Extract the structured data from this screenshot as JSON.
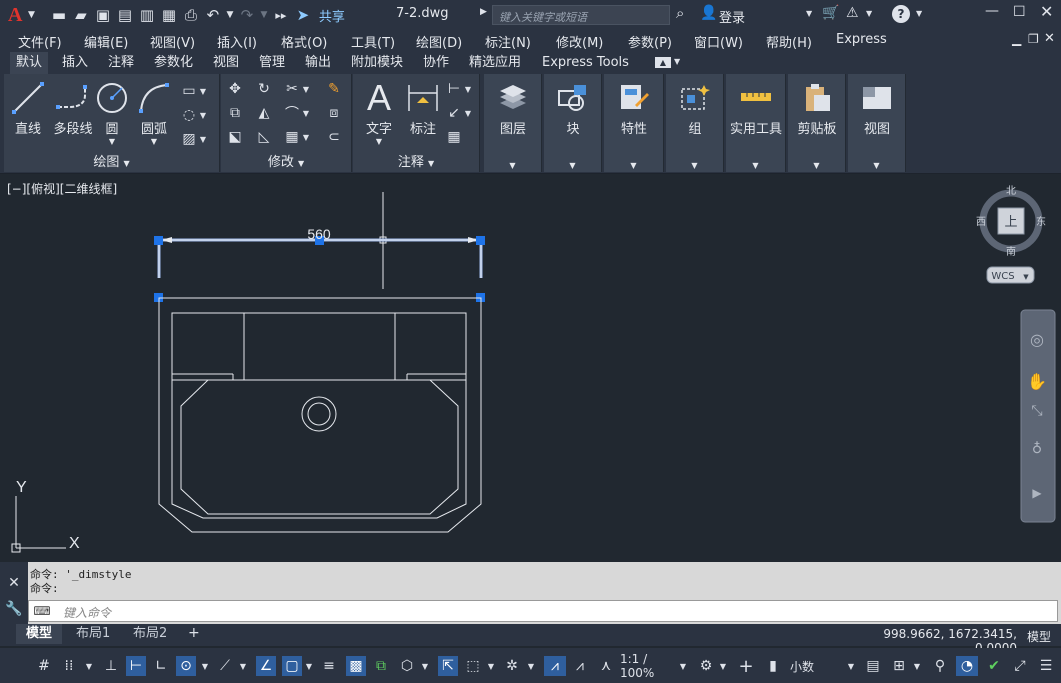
{
  "titlebar": {
    "app_logo": "A",
    "share_label": "共享",
    "filename": "7-2.dwg",
    "search_placeholder": "键入关键字或短语",
    "login_label": "登录"
  },
  "menu": [
    "文件(F)",
    "编辑(E)",
    "视图(V)",
    "插入(I)",
    "格式(O)",
    "工具(T)",
    "绘图(D)",
    "标注(N)",
    "修改(M)",
    "参数(P)",
    "窗口(W)",
    "帮助(H)",
    "Express"
  ],
  "ribbon_tabs": [
    "默认",
    "插入",
    "注释",
    "参数化",
    "视图",
    "管理",
    "输出",
    "附加模块",
    "协作",
    "精选应用",
    "Express Tools"
  ],
  "ribbon": {
    "draw_buttons": [
      "直线",
      "多段线",
      "圆",
      "圆弧"
    ],
    "draw_panel": "绘图",
    "modify_panel": "修改",
    "annot_buttons": [
      "文字",
      "标注"
    ],
    "annot_panel": "注释",
    "big_panels": [
      "图层",
      "块",
      "特性",
      "组",
      "实用工具",
      "剪贴板",
      "视图"
    ]
  },
  "viewport": {
    "label": "[−][俯视][二维线框]",
    "dimension_text": "560",
    "ucs_y": "Y",
    "ucs_x": "X",
    "compass": {
      "north": "北",
      "south": "南",
      "east": "东",
      "west": "西",
      "top": "上"
    },
    "wcs": "WCS"
  },
  "command": {
    "history": [
      "命令: '_dimstyle",
      "命令:"
    ],
    "placeholder": "键入命令"
  },
  "layout_tabs": [
    "模型",
    "布局1",
    "布局2"
  ],
  "coordinates": "998.9662, 1672.3415, 0.0000",
  "model_label": "模型",
  "status": {
    "scale": "1:1 / 100%",
    "units": "小数"
  },
  "colors": {
    "accent": "#2f6fd0",
    "grip": "#1e73e8",
    "logo": "#e0342d"
  }
}
